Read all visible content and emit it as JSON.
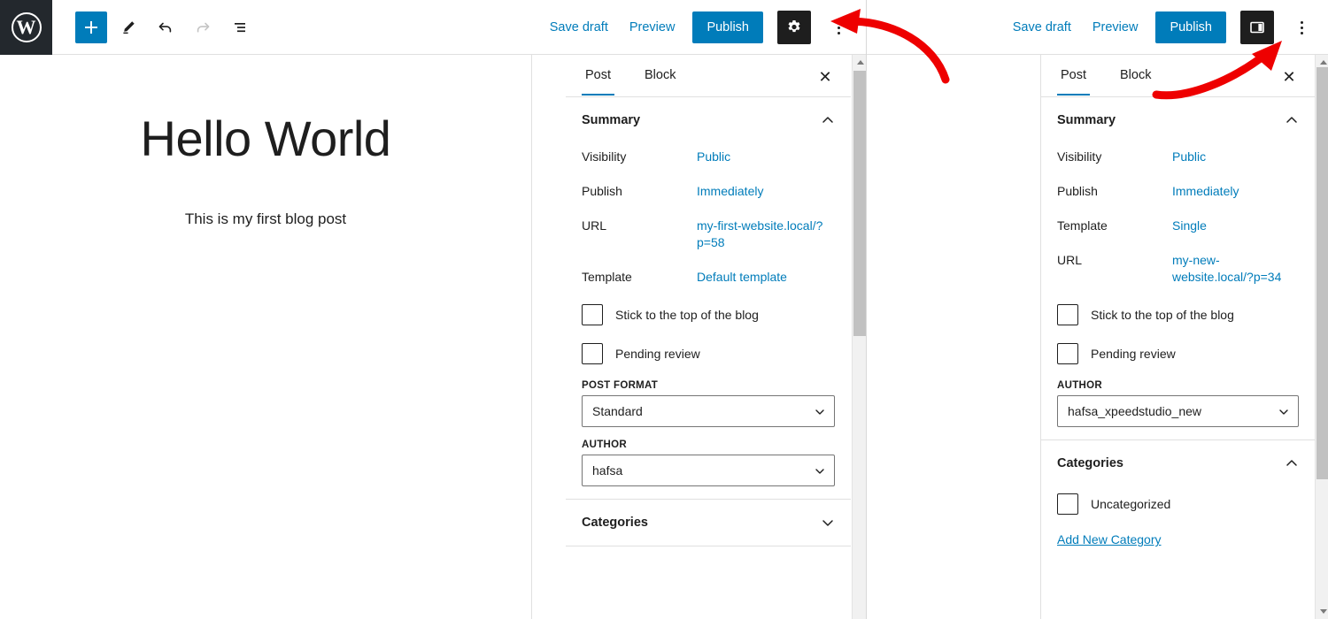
{
  "colors": {
    "accent": "#007cba",
    "dark": "#1e1e1e",
    "wp_bar": "#23282d",
    "border": "#e0e0e0",
    "annotation": "#ee0000"
  },
  "editor": {
    "logo_alt": "W",
    "toolbar": {
      "add_block": "+",
      "icons": [
        "add-block-icon",
        "edit-pencil-icon",
        "undo-icon",
        "redo-icon",
        "list-view-icon"
      ]
    },
    "post": {
      "title": "Hello World",
      "body": "This is my first blog post"
    }
  },
  "left_capture": {
    "topbar": {
      "save_draft": "Save draft",
      "preview": "Preview",
      "publish": "Publish",
      "settings_icon": "gear-icon",
      "more_icon": "kebab-menu-icon"
    },
    "sidebar": {
      "tabs": [
        {
          "label": "Post",
          "active": true
        },
        {
          "label": "Block",
          "active": false
        }
      ],
      "close_label": "✕",
      "summary": {
        "title": "Summary",
        "expanded": true,
        "rows": [
          {
            "key": "Visibility",
            "value": "Public"
          },
          {
            "key": "Publish",
            "value": "Immediately"
          },
          {
            "key": "URL",
            "value": "my-first-website.local/?p=58"
          },
          {
            "key": "Template",
            "value": "Default template"
          }
        ],
        "checkboxes": [
          {
            "label": "Stick to the top of the blog",
            "checked": false
          },
          {
            "label": "Pending review",
            "checked": false
          }
        ],
        "fields": [
          {
            "label": "POST FORMAT",
            "value": "Standard"
          },
          {
            "label": "AUTHOR",
            "value": "hafsa"
          }
        ]
      },
      "categories": {
        "title": "Categories",
        "expanded": false
      }
    }
  },
  "right_capture": {
    "topbar": {
      "save_draft": "Save draft",
      "preview": "Preview",
      "publish": "Publish",
      "settings_icon": "sidebar-panel-icon",
      "more_icon": "kebab-menu-icon"
    },
    "sidebar": {
      "tabs": [
        {
          "label": "Post",
          "active": true
        },
        {
          "label": "Block",
          "active": false
        }
      ],
      "close_label": "✕",
      "summary": {
        "title": "Summary",
        "expanded": true,
        "rows": [
          {
            "key": "Visibility",
            "value": "Public"
          },
          {
            "key": "Publish",
            "value": "Immediately"
          },
          {
            "key": "Template",
            "value": "Single"
          },
          {
            "key": "URL",
            "value": "my-new-website.local/?p=34"
          }
        ],
        "checkboxes": [
          {
            "label": "Stick to the top of the blog",
            "checked": false
          },
          {
            "label": "Pending review",
            "checked": false
          }
        ],
        "fields": [
          {
            "label": "AUTHOR",
            "value": "hafsa_xpeedstudio_new"
          }
        ]
      },
      "categories": {
        "title": "Categories",
        "expanded": true,
        "items": [
          {
            "label": "Uncategorized",
            "checked": false
          }
        ],
        "add_new": "Add New Category"
      }
    }
  },
  "annotations": [
    {
      "name": "arrow-to-settings-gear",
      "target": "gear-icon"
    },
    {
      "name": "arrow-to-sidebar-toggle",
      "target": "sidebar-panel-icon"
    }
  ]
}
